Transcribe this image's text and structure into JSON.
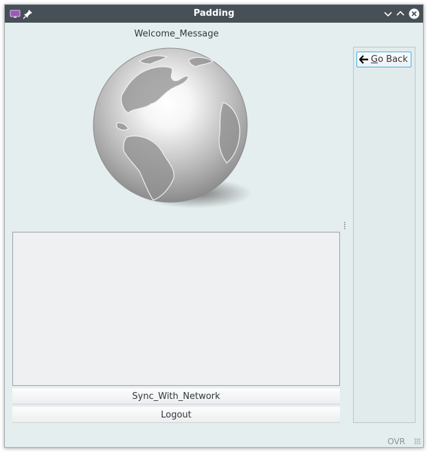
{
  "window": {
    "title": "Padding",
    "app_icon": "monitor-icon",
    "pin_icon": "pin-icon",
    "controls": [
      "minimize-chevron-icon",
      "maximize-chevron-icon",
      "close-icon"
    ]
  },
  "main": {
    "welcome_message": "Welcome_Message",
    "image": "globe-icon",
    "text_area_value": ""
  },
  "buttons": {
    "sync": "Sync_With_Network",
    "logout": "Logout"
  },
  "side_panel": {
    "go_back_mnemonic": "G",
    "go_back_rest": "o Back",
    "go_back_icon": "arrow-left-icon"
  },
  "status": {
    "mode": "OVR"
  },
  "colors": {
    "titlebar": "#475057",
    "window_bg": "#e5eeef",
    "focus_border": "#3daee9"
  }
}
